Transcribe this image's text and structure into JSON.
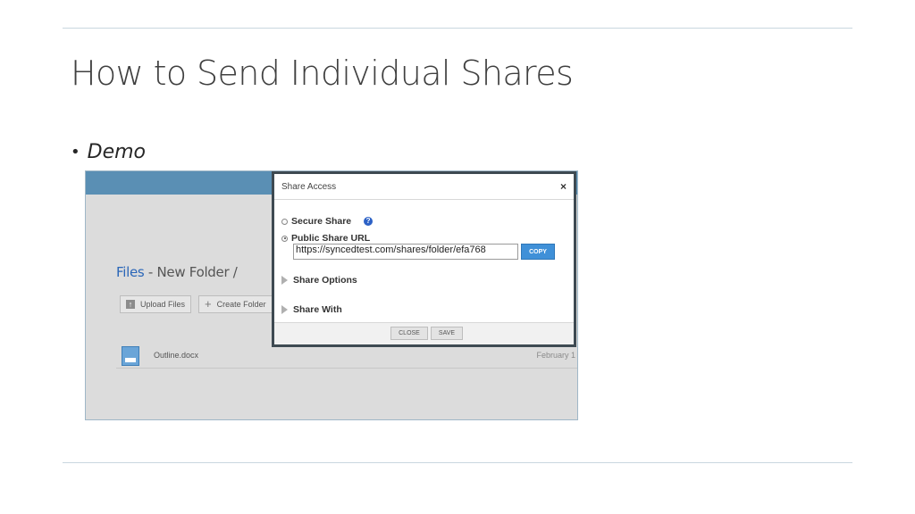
{
  "slide": {
    "title": "How to Send Individual Shares",
    "bullet_mark": "•",
    "bullet_text": "Demo"
  },
  "app": {
    "breadcrumb": {
      "root": "Files",
      "separator": " - ",
      "current": "New Folder /"
    },
    "toolbar": {
      "upload_label": "Upload Files",
      "create_folder_label": "Create Folder"
    },
    "files": [
      {
        "name": "Outline.docx",
        "date": "February 1"
      }
    ]
  },
  "dialog": {
    "title": "Share Access",
    "close_glyph": "×",
    "options": [
      {
        "label": "Secure Share",
        "selected": false
      },
      {
        "label": "Public Share URL",
        "selected": true
      }
    ],
    "help_glyph": "?",
    "share_url": "https://syncedtest.com/shares/folder/efa768",
    "copy_label": "COPY",
    "sections": [
      "Share Options",
      "Share With"
    ],
    "close_label": "CLOSE",
    "save_label": "SAVE"
  },
  "colors": {
    "title_text": "#404040",
    "app_topbar": "#5a8fb4",
    "link": "#2a66b8",
    "copy_button": "#3f90d8",
    "help_icon": "#2c61c6",
    "modal_border": "#3e4a52"
  }
}
